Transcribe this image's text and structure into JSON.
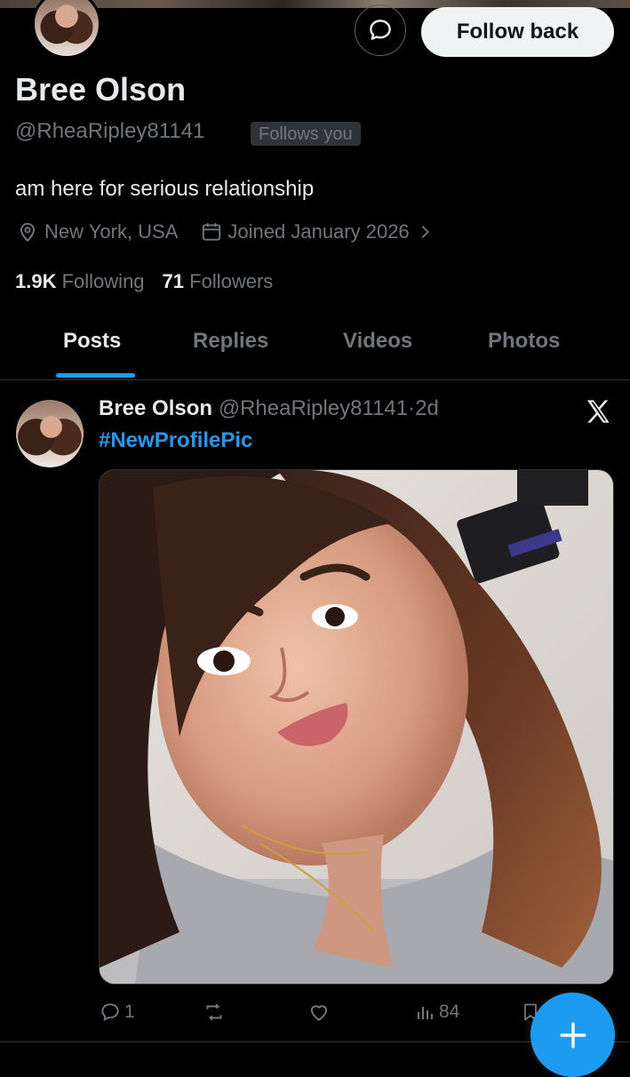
{
  "header": {
    "follow_button_label": "Follow back",
    "message_icon": "message-bubble-icon"
  },
  "profile": {
    "name": "Bree Olson",
    "handle": "@RheaRipley81141",
    "follows_you_badge": "Follows you",
    "bio": "am here for serious relationship",
    "location": "New York, USA",
    "joined": "Joined January 2026",
    "following_count": "1.9K",
    "following_label": "Following",
    "followers_count": "71",
    "followers_label": "Followers"
  },
  "tabs": [
    {
      "label": "Posts",
      "active": true
    },
    {
      "label": "Replies",
      "active": false
    },
    {
      "label": "Videos",
      "active": false
    },
    {
      "label": "Photos",
      "active": false
    }
  ],
  "post": {
    "author_name": "Bree Olson",
    "author_handle": "@RheaRipley81141",
    "separator": "·",
    "time": "2d",
    "text": "#NewProfilePic",
    "replies": "1",
    "reposts": "",
    "likes": "",
    "views": "84"
  },
  "colors": {
    "background": "#000000",
    "accent": "#1d9bf0",
    "secondary_text": "#71767b",
    "primary_text": "#e7e9ea"
  }
}
